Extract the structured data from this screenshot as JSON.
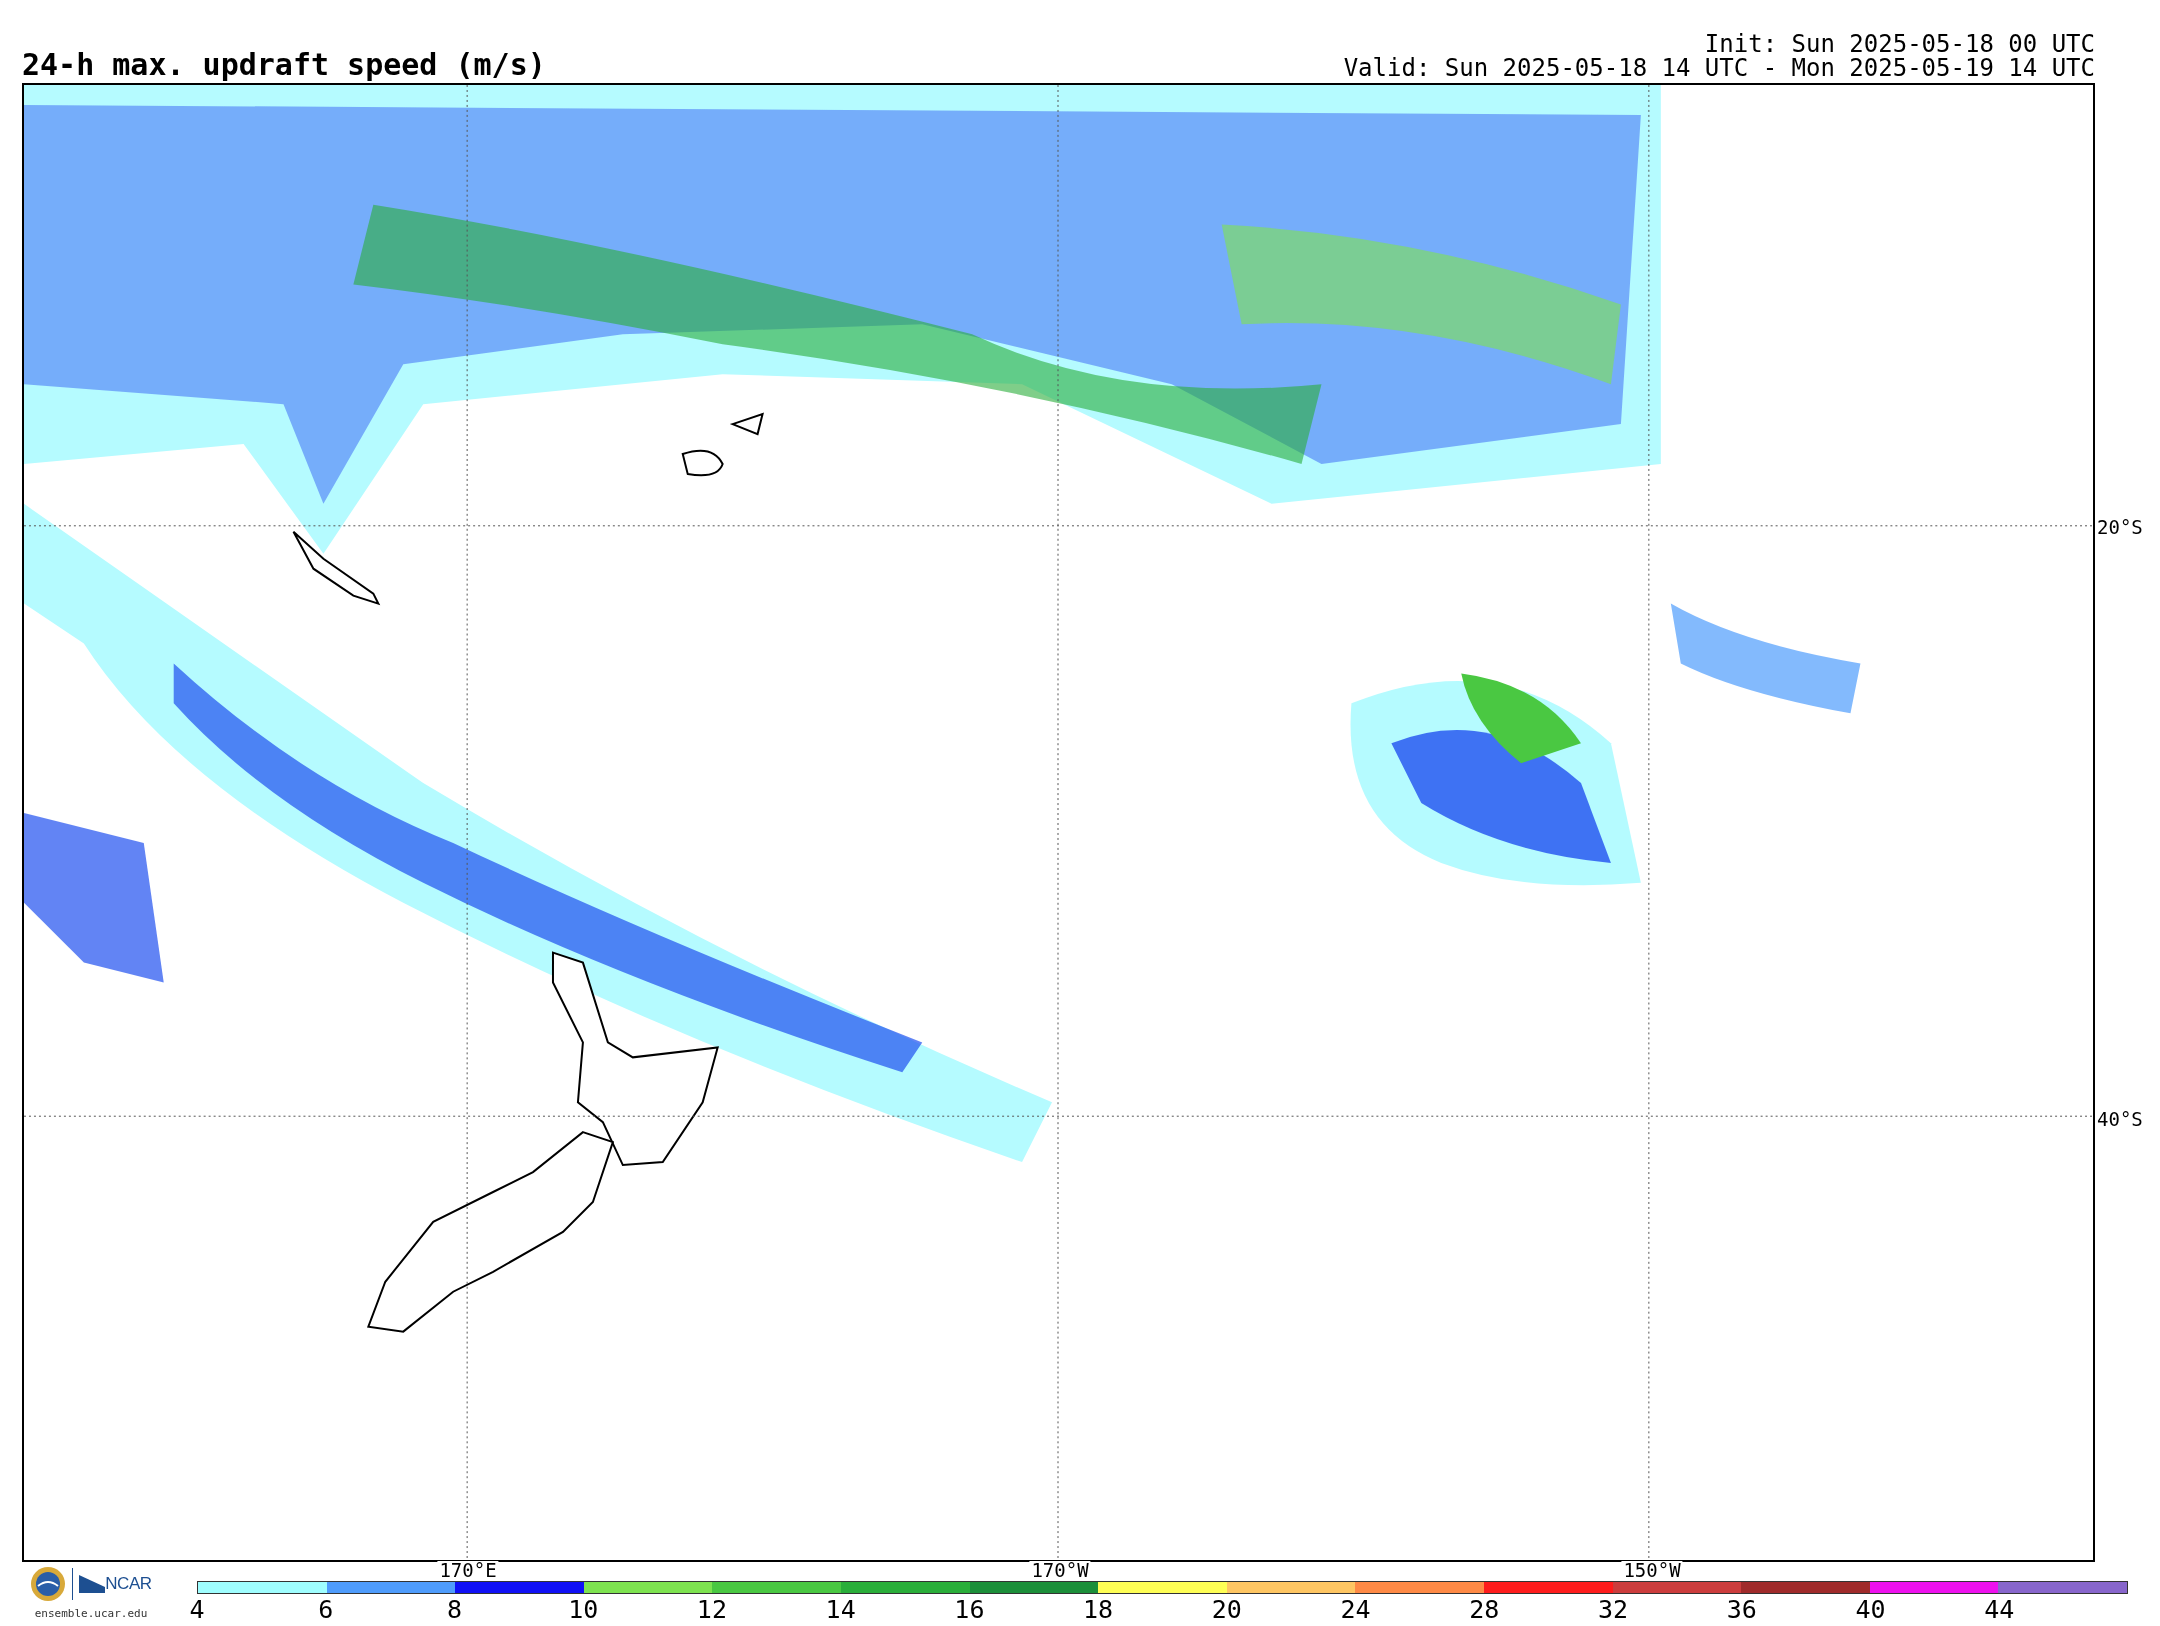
{
  "title": "24-h max. updraft speed (m/s)",
  "init": "Init: Sun 2025-05-18 00 UTC",
  "valid": "Valid: Sun 2025-05-18 14 UTC - Mon 2025-05-19 14 UTC",
  "map": {
    "lat_labels": [
      "20°S",
      "40°S"
    ],
    "lon_labels": [
      "170°E",
      "170°W",
      "150°W"
    ]
  },
  "logo": {
    "name": "NCAR",
    "url": "ensemble.ucar.edu"
  },
  "legend": {
    "segments": [
      {
        "color": "#9ffeff"
      },
      {
        "color": "#4f9cfc"
      },
      {
        "color": "#1010f5"
      },
      {
        "color": "#7ee350"
      },
      {
        "color": "#4ac842"
      },
      {
        "color": "#2aae3a"
      },
      {
        "color": "#1c8f3a"
      },
      {
        "color": "#ffff55"
      },
      {
        "color": "#ffc663"
      },
      {
        "color": "#ff8a46"
      },
      {
        "color": "#ff1c1c"
      },
      {
        "color": "#cc3d3d"
      },
      {
        "color": "#a02b2b"
      },
      {
        "color": "#ee10ee"
      },
      {
        "color": "#8866cc"
      }
    ],
    "ticks": [
      "4",
      "6",
      "8",
      "10",
      "12",
      "14",
      "16",
      "18",
      "20",
      "24",
      "28",
      "32",
      "36",
      "40",
      "44"
    ]
  }
}
